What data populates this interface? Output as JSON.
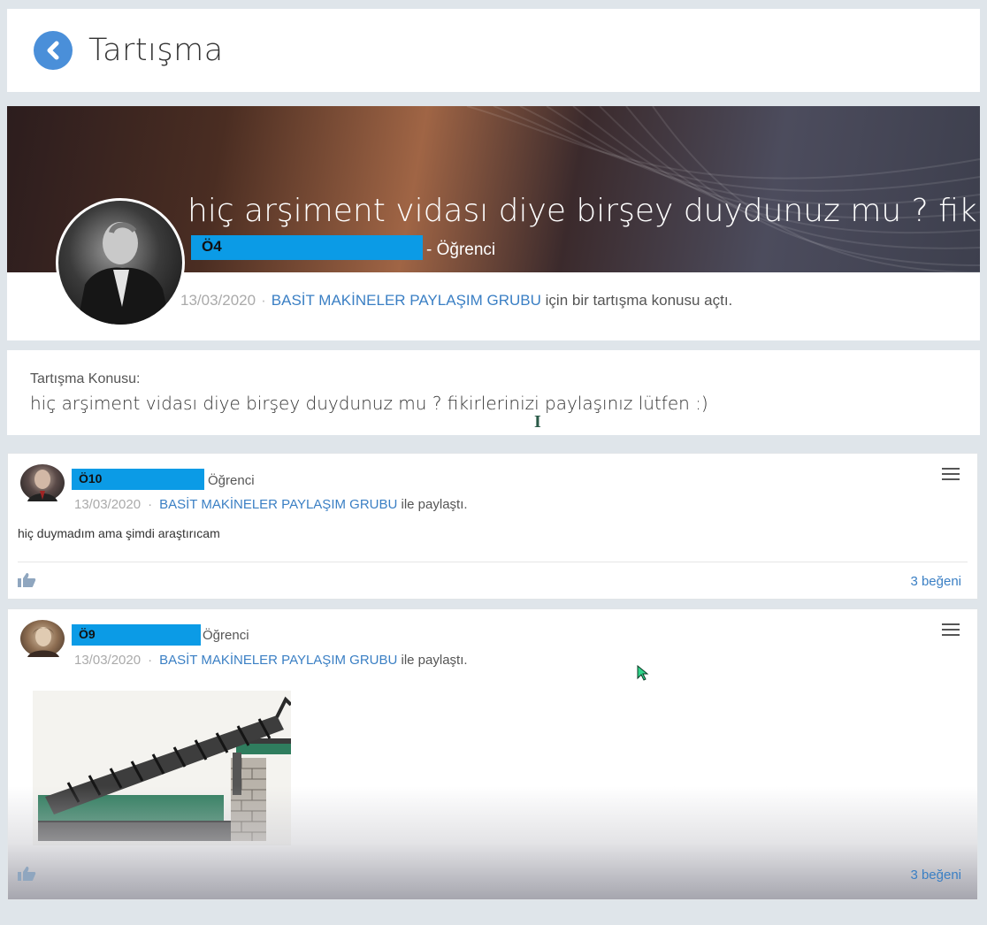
{
  "header": {
    "title": "Tartışma",
    "back_icon": "chevron-left-icon",
    "accent": "#4a8fd9"
  },
  "topic": {
    "title": "hiç arşiment vidası diye birşey duydunuz mu ? fikirleri",
    "author": "Ö4",
    "role": "- Öğrenci",
    "date": "13/03/2020",
    "separator": "·",
    "group": "BASİT MAKİNELER PAYLAŞIM GRUBU",
    "action": "için bir tartışma konusu açtı.",
    "description_label": "Tartışma Konusu:",
    "description": "hiç arşiment vidası diye birşey duydunuz mu ? fikirlerinizi paylaşınız lütfen :)"
  },
  "posts": [
    {
      "author": "Ö10",
      "role": "Öğrenci",
      "date": "13/03/2020",
      "separator": "·",
      "group": "BASİT MAKİNELER PAYLAŞIM GRUBU",
      "action": "ile paylaştı.",
      "text": "hiç duymadım ama şimdi araştırıcam",
      "likes": "3 beğeni"
    },
    {
      "author": "Ö9",
      "role": "Öğrenci",
      "date": "13/03/2020",
      "separator": "·",
      "group": "BASİT MAKİNELER PAYLAŞIM GRUBU",
      "action": "ile paylaştı.",
      "likes": "3 beğeni"
    }
  ],
  "colors": {
    "name_highlight": "#0b9be6",
    "link": "#3a7fc4"
  }
}
